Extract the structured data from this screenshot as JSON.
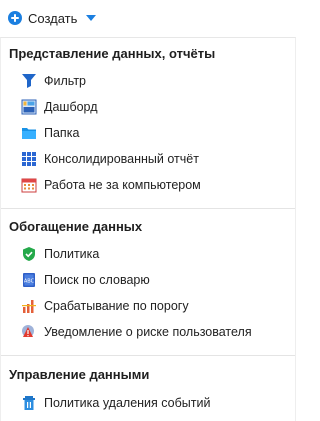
{
  "header": {
    "create_label": "Создать"
  },
  "sections": [
    {
      "title": "Представление данных, отчёты",
      "items": [
        {
          "label": "Фильтр",
          "icon": "filter-icon"
        },
        {
          "label": "Дашборд",
          "icon": "dashboard-icon"
        },
        {
          "label": "Папка",
          "icon": "folder-icon"
        },
        {
          "label": "Консолидированный отчёт",
          "icon": "consolidated-report-icon"
        },
        {
          "label": "Работа не за компьютером",
          "icon": "calendar-icon"
        }
      ]
    },
    {
      "title": "Обогащение данных",
      "items": [
        {
          "label": "Политика",
          "icon": "shield-check-icon"
        },
        {
          "label": "Поиск по словарю",
          "icon": "dictionary-icon"
        },
        {
          "label": "Срабатывание по порогу",
          "icon": "threshold-chart-icon"
        },
        {
          "label": "Уведомление о риске пользователя",
          "icon": "user-risk-warning-icon"
        }
      ]
    },
    {
      "title": "Управление данными",
      "items": [
        {
          "label": "Политика удаления событий",
          "icon": "delete-policy-icon"
        }
      ]
    }
  ],
  "colors": {
    "accent": "#1b7fe0",
    "text": "#222222",
    "divider": "#e4e4e4"
  }
}
